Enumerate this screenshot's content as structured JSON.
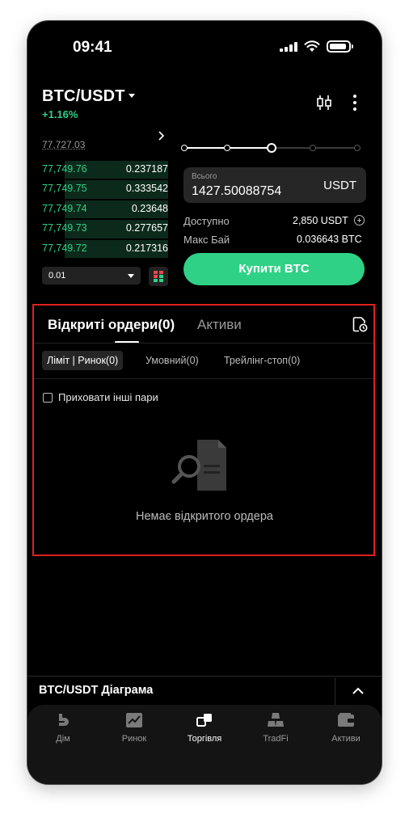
{
  "status_bar": {
    "time": "09:41"
  },
  "header": {
    "pair": "BTC/USDT",
    "change": "+1.16%"
  },
  "order_book": {
    "top_price": "77,727.03",
    "bids": [
      {
        "price": "77,749.76",
        "qty": "0.237187",
        "depth": 0.82
      },
      {
        "price": "77,749.75",
        "qty": "0.333542",
        "depth": 0.82
      },
      {
        "price": "77,749.74",
        "qty": "0.23648",
        "depth": 0.82
      },
      {
        "price": "77,749.73",
        "qty": "0.277657",
        "depth": 0.82
      },
      {
        "price": "77,749.72",
        "qty": "0.217316",
        "depth": 0.82
      }
    ],
    "step": "0.01"
  },
  "order_form": {
    "slider_position": 0.5,
    "total_label": "Всього",
    "total_value": "1427.50088754",
    "total_unit": "USDT",
    "available_label": "Доступно",
    "available_value": "2,850 USDT",
    "max_buy_label": "Макс Бай",
    "max_buy_value": "0.036643 BTC",
    "buy_button": "Купити BTC"
  },
  "orders": {
    "tab_open": "Відкриті ордери(0)",
    "tab_assets": "Активи",
    "chip_limit_market": "Ліміт | Ринок(0)",
    "chip_conditional": "Умовний(0)",
    "chip_trailing": "Трейлінг-стоп(0)",
    "hide_other_pairs": "Приховати інші пари",
    "empty_text": "Немає відкритого ордера"
  },
  "chart_bar": {
    "label": "BTC/USDT Діаграма"
  },
  "bottom_nav": {
    "items": [
      {
        "label": "Дім",
        "icon": "home-icon"
      },
      {
        "label": "Ринок",
        "icon": "market-chart-icon"
      },
      {
        "label": "Торгівля",
        "icon": "trade-icon"
      },
      {
        "label": "TradFi",
        "icon": "gold-bars-icon"
      },
      {
        "label": "Активи",
        "icon": "wallet-icon"
      }
    ],
    "active_index": 2
  },
  "colors": {
    "accent_green": "#2fd186",
    "bid_depth": "#0c2a1b",
    "highlight_frame": "#e02020",
    "background": "#000000"
  }
}
